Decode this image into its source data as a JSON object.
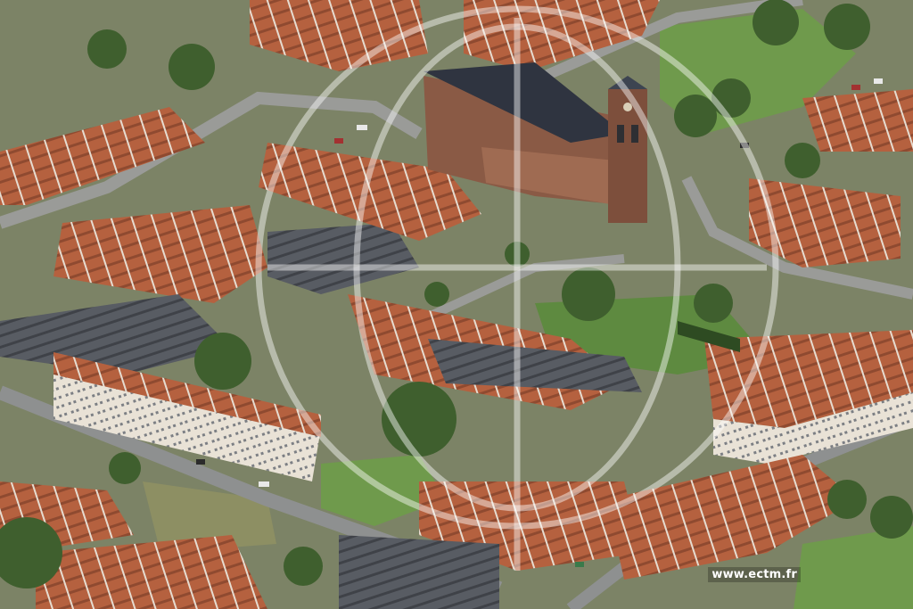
{
  "photo": {
    "credit_text": "www.ectm.fr",
    "colors": {
      "roof_terracotta": "#b5613f",
      "roof_slate": "#3d4451",
      "church_brick": "#8a5a45",
      "grass": "#6f9a4c",
      "tree": "#3f5f2e",
      "street": "#8e9090",
      "watermark": "#ffffff"
    }
  }
}
